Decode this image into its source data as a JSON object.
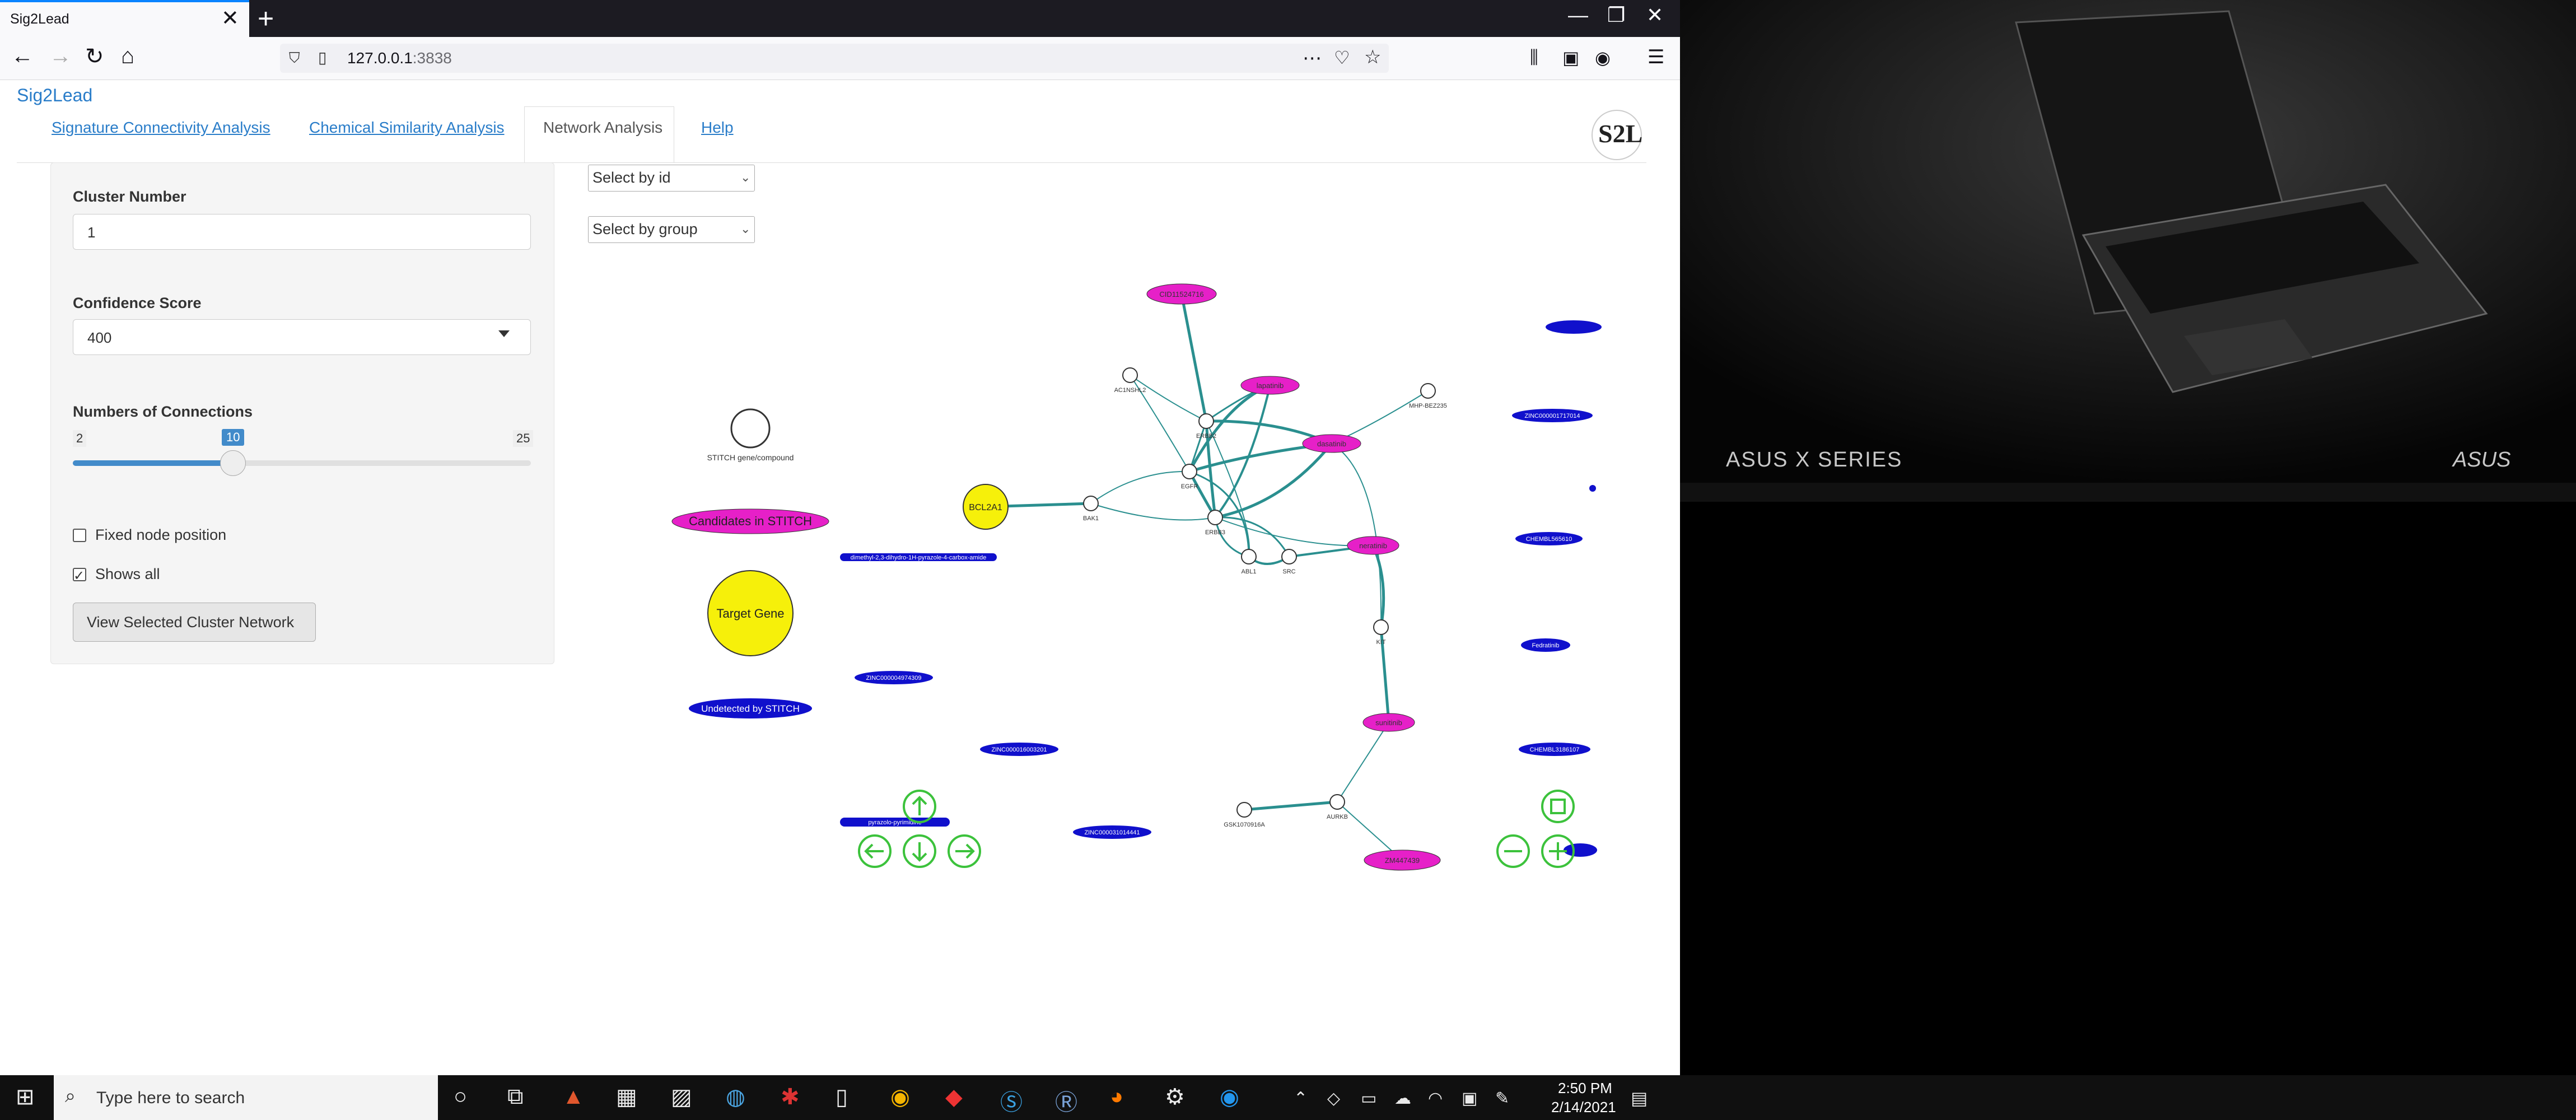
{
  "browser": {
    "tab_title": "Sig2Lead",
    "tab_close": "✕",
    "new_tab": "+",
    "url_host": "127.0.0.1",
    "url_port": ":3838",
    "win_min": "—",
    "win_max": "❐",
    "win_close": "✕"
  },
  "app": {
    "brand": "Sig2Lead",
    "logo": "S2L",
    "nav": {
      "signature": "Signature Connectivity Analysis",
      "chemical": "Chemical Similarity Analysis",
      "network": "Network Analysis",
      "help": "Help"
    }
  },
  "sidebar": {
    "cluster_label": "Cluster Number",
    "cluster_value": "1",
    "confidence_label": "Confidence Score",
    "confidence_value": "400",
    "connections_label": "Numbers of Connections",
    "slider_min": "2",
    "slider_value": "10",
    "slider_max": "25",
    "slider_fraction": 0.35,
    "fixed_node_label": "Fixed node position",
    "fixed_node_checked": false,
    "shows_all_label": "Shows all",
    "shows_all_checked": true,
    "view_button": "View Selected Cluster Network"
  },
  "network": {
    "select_id": "Select by id",
    "select_group": "Select by group",
    "legend": {
      "stitch": "STITCH gene/compound",
      "candidates": "Candidates in STITCH",
      "target": "Target Gene",
      "undetected": "Undetected by STITCH"
    },
    "target_node": "BCL2A1",
    "gene_nodes": [
      "AC1NSHL2",
      "MHP-BEZ235",
      "ERBB2",
      "BAK1",
      "EGFR",
      "ERBB3",
      "ABL1",
      "SRC",
      "KIT",
      "AURKB",
      "GSK1070916A"
    ],
    "compound_nodes": [
      "CID11524716",
      "lapatinib",
      "dasatinib",
      "neratinib",
      "sunitinib",
      "ZM447439"
    ],
    "undetected_nodes": [
      "dimethyl-2,3-dihydro-1H-pyrazole-4-carbox-amide",
      "ZINC000004974309",
      "ZINC000016003201",
      "ZINC000031014441",
      "pyrazolo-pyrimidine",
      "ZINC000001717014",
      "CHEMBL565610",
      "Fedratinib",
      "CHEMBL3186107"
    ]
  },
  "desktop": {
    "series": "ASUS X SERIES",
    "brand": "ASUS"
  },
  "taskbar": {
    "search_placeholder": "Type here to search",
    "time": "2:50 PM",
    "date": "2/14/2021"
  }
}
